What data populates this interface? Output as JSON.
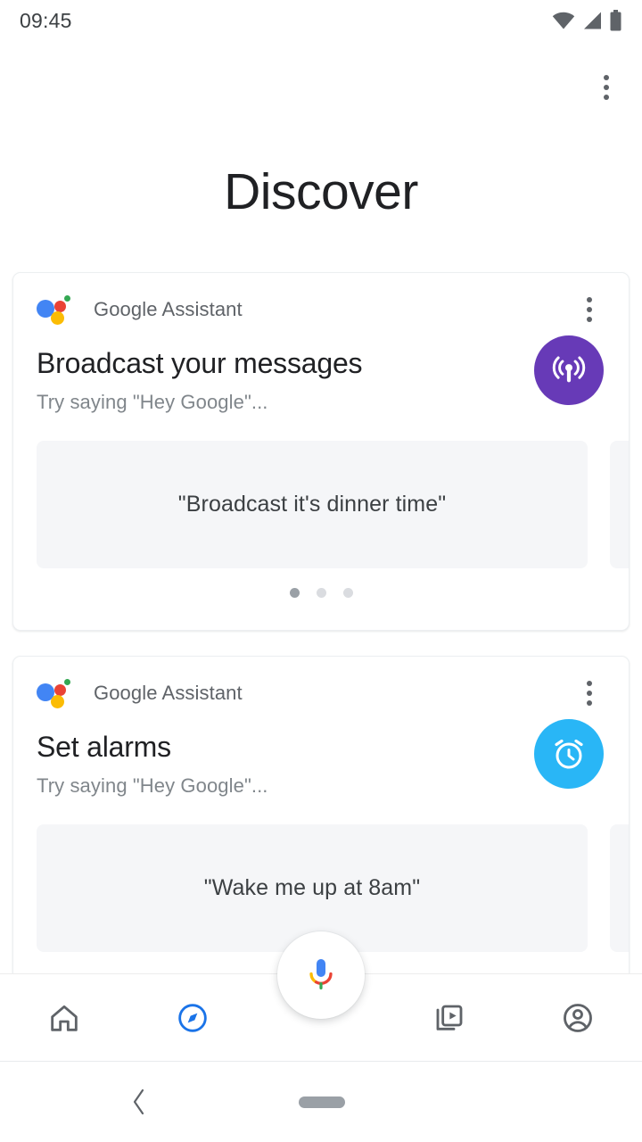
{
  "status_bar": {
    "time": "09:45",
    "icons": [
      "wifi-icon",
      "cell-signal-icon",
      "battery-icon"
    ]
  },
  "header": {
    "overflow_icon": "more-vert-icon",
    "title": "Discover"
  },
  "cards": [
    {
      "id": "broadcast",
      "source": "Google Assistant",
      "source_logo": "google-assistant-logo",
      "overflow_icon": "more-vert-icon",
      "title": "Broadcast your messages",
      "subtitle": "Try saying \"Hey Google\"...",
      "action_icon": "broadcast-icon",
      "action_color": "#673AB7",
      "chips": [
        "\"Broadcast it's dinner time\""
      ],
      "pages": 3,
      "active_page": 1
    },
    {
      "id": "alarms",
      "source": "Google Assistant",
      "source_logo": "google-assistant-logo",
      "overflow_icon": "more-vert-icon",
      "title": "Set alarms",
      "subtitle": "Try saying \"Hey Google\"...",
      "action_icon": "alarm-clock-icon",
      "action_color": "#29B6F6",
      "chips": [
        "\"Wake me up at 8am\""
      ],
      "pages": 3,
      "active_page": 1
    }
  ],
  "bottom_nav": {
    "items": [
      {
        "icon": "home-icon",
        "active": false
      },
      {
        "icon": "compass-discover-icon",
        "active": true
      },
      {
        "icon": "collections-video-icon",
        "active": false
      },
      {
        "icon": "account-circle-icon",
        "active": false
      }
    ],
    "fab_icon": "google-mic-icon",
    "active_color": "#1A73E8",
    "inactive_color": "#5f6368"
  },
  "system_nav": {
    "back_icon": "back-chevron-icon",
    "home_icon": "home-pill-icon"
  }
}
